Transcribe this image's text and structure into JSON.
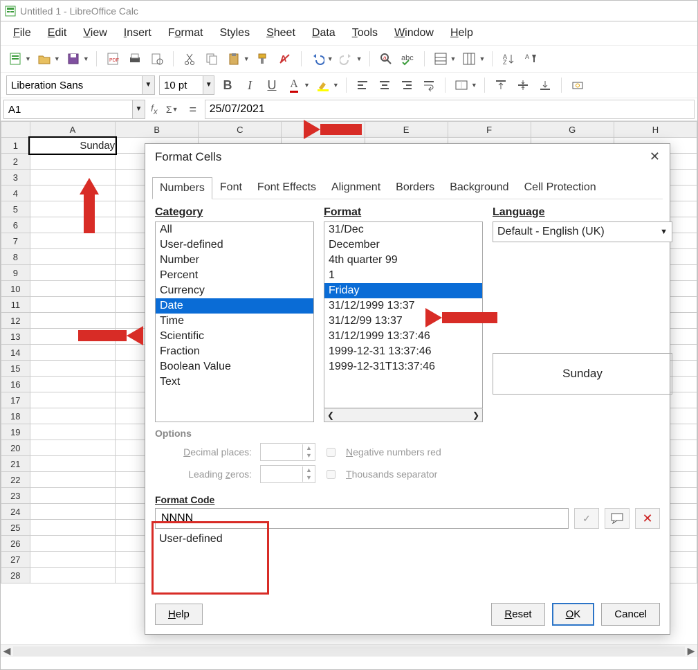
{
  "window": {
    "title": "Untitled 1 - LibreOffice Calc"
  },
  "menu": {
    "items": [
      "File",
      "Edit",
      "View",
      "Insert",
      "Format",
      "Styles",
      "Sheet",
      "Data",
      "Tools",
      "Window",
      "Help"
    ]
  },
  "formatbar": {
    "font": "Liberation Sans",
    "size": "10 pt"
  },
  "namebox": "A1",
  "formula": "25/07/2021",
  "cell": {
    "a1": "Sunday"
  },
  "columns": [
    "A",
    "B",
    "C",
    "D",
    "E",
    "F",
    "G",
    "H"
  ],
  "rows": 28,
  "dialog": {
    "title": "Format Cells",
    "tabs": [
      "Numbers",
      "Font",
      "Font Effects",
      "Alignment",
      "Borders",
      "Background",
      "Cell Protection"
    ],
    "activeTab": 0,
    "headers": {
      "category": "Category",
      "format": "Format",
      "language": "Language",
      "options": "Options",
      "formatcode": "Format Code"
    },
    "categories": [
      "All",
      "User-defined",
      "Number",
      "Percent",
      "Currency",
      "Date",
      "Time",
      "Scientific",
      "Fraction",
      "Boolean Value",
      "Text"
    ],
    "selCategory": "Date",
    "formats": [
      "31/Dec",
      "December",
      "4th quarter 99",
      "1",
      "Friday",
      "31/12/1999 13:37",
      "31/12/99 13:37",
      "31/12/1999 13:37:46",
      "1999-12-31 13:37:46",
      "1999-12-31T13:37:46"
    ],
    "selFormat": "Friday",
    "language": "Default - English (UK)",
    "preview": "Sunday",
    "options": {
      "decimal": "Decimal places:",
      "zeros": "Leading zeros:",
      "negred": "Negative numbers red",
      "thou": "Thousands separator"
    },
    "formatCode": "NNNN",
    "userDefined": "User-defined",
    "buttons": {
      "help": "Help",
      "reset": "Reset",
      "ok": "OK",
      "cancel": "Cancel"
    }
  }
}
